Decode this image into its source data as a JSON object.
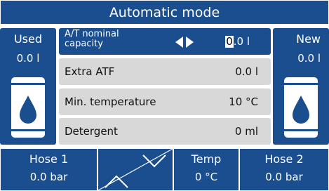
{
  "title": "Automatic mode",
  "used": {
    "label": "Used",
    "value": "0.0 l"
  },
  "new": {
    "label": "New",
    "value": "0.0 l"
  },
  "rows": [
    {
      "name_line1": "A/T nominal",
      "name_line2": "capacity",
      "value_cursor": "0",
      "value_rest": ".0 l"
    },
    {
      "name": "Extra ATF",
      "value": "0.0 l"
    },
    {
      "name": "Min. temperature",
      "value": "10 °C"
    },
    {
      "name": "Detergent",
      "value": "0 ml"
    }
  ],
  "bottom": {
    "hose1": {
      "label": "Hose 1",
      "value": "0.0 bar"
    },
    "temp": {
      "label": "Temp",
      "value": "0 °C"
    },
    "hose2": {
      "label": "Hose 2",
      "value": "0.0 bar"
    }
  },
  "icons": [
    "left-right-arrows-icon",
    "oil-canister-icon",
    "chevron-down-icon",
    "chevron-up-icon"
  ],
  "colors": {
    "accent": "#1b4e8f",
    "row_bg": "#d8d8d8"
  }
}
